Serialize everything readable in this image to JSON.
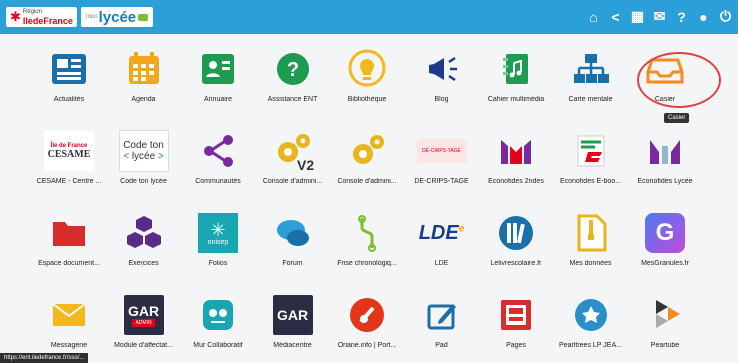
{
  "header": {
    "region_small": "Région",
    "region_name": "IledeFrance",
    "mon": "mon",
    "lycee": "lycée",
    "icons": [
      "home-icon",
      "share-icon",
      "apps-grid-icon",
      "mail-icon",
      "help-icon",
      "user-icon",
      "power-icon"
    ],
    "color": "#2a9fd8"
  },
  "apps": [
    {
      "label": "Actualités",
      "icon": "newspaper-icon"
    },
    {
      "label": "Agenda",
      "icon": "calendar-icon"
    },
    {
      "label": "Annuaire",
      "icon": "contact-card-icon"
    },
    {
      "label": "Assistance ENT",
      "icon": "question-icon"
    },
    {
      "label": "Bibliothèque",
      "icon": "lightbulb-icon"
    },
    {
      "label": "Blog",
      "icon": "megaphone-icon"
    },
    {
      "label": "Cahier multimédia",
      "icon": "notebook-icon"
    },
    {
      "label": "Carte mentale",
      "icon": "sitemap-icon"
    },
    {
      "label": "Casier",
      "icon": "inbox-tray-icon"
    },
    {
      "label": "CESAME - Centre ...",
      "icon": "cesame-logo-icon",
      "logo_top": "Île de France",
      "logo_text": "CESAME"
    },
    {
      "label": "Code ton lycée",
      "icon": "code-ton-lycee-icon",
      "logo_text": "Code ton",
      "logo_text2": "< lycée >"
    },
    {
      "label": "Communautés",
      "icon": "network-share-icon"
    },
    {
      "label": "Console d'admini...",
      "icon": "gears-v2-icon",
      "badge": "V2"
    },
    {
      "label": "Console d'admini...",
      "icon": "gears-icon"
    },
    {
      "label": "DÉ-CRIPS-TAGE",
      "icon": "decripstage-logo-icon",
      "logo_text": "DÉ-CRIPS-TAGE"
    },
    {
      "label": "Econofides 2ndes",
      "icon": "econofides-m-icon"
    },
    {
      "label": "Econofides E-boo...",
      "icon": "econofides-e-icon"
    },
    {
      "label": "Econofides Lycée",
      "icon": "econofides-n-icon"
    },
    {
      "label": "Espace document...",
      "icon": "folder-icon"
    },
    {
      "label": "Exercices",
      "icon": "cubes-icon"
    },
    {
      "label": "Folios",
      "icon": "onisep-icon",
      "logo_text": "onisep"
    },
    {
      "label": "Forum",
      "icon": "speech-bubbles-icon"
    },
    {
      "label": "Frise chronologiq...",
      "icon": "timeline-icon"
    },
    {
      "label": "LDE",
      "icon": "lde-logo-icon",
      "logo_text": "LDE"
    },
    {
      "label": "Lelivrescolaire.fr",
      "icon": "books-icon"
    },
    {
      "label": "Mes données",
      "icon": "zip-file-icon"
    },
    {
      "label": "MesGranules.fr",
      "icon": "granules-g-icon",
      "logo_text": "G"
    },
    {
      "label": "Messagerie",
      "icon": "envelope-icon"
    },
    {
      "label": "Module d'affectat...",
      "icon": "gar-admin-icon",
      "logo_text": "GAR",
      "logo_text2": "ADMIN"
    },
    {
      "label": "Mur Collaboratif",
      "icon": "padlet-icon"
    },
    {
      "label": "Médiacentre",
      "icon": "gar-icon",
      "logo_text": "GAR"
    },
    {
      "label": "Oriane.info | Port...",
      "icon": "oriane-icon"
    },
    {
      "label": "Pad",
      "icon": "pad-icon"
    },
    {
      "label": "Pages",
      "icon": "pages-icon"
    },
    {
      "label": "Pearltrees LP JEA...",
      "icon": "pearltrees-icon"
    },
    {
      "label": "Peartube",
      "icon": "peertube-icon"
    }
  ],
  "tooltip": "Casier",
  "status_url": "https://ent.iledefrance.fr/sso/..."
}
